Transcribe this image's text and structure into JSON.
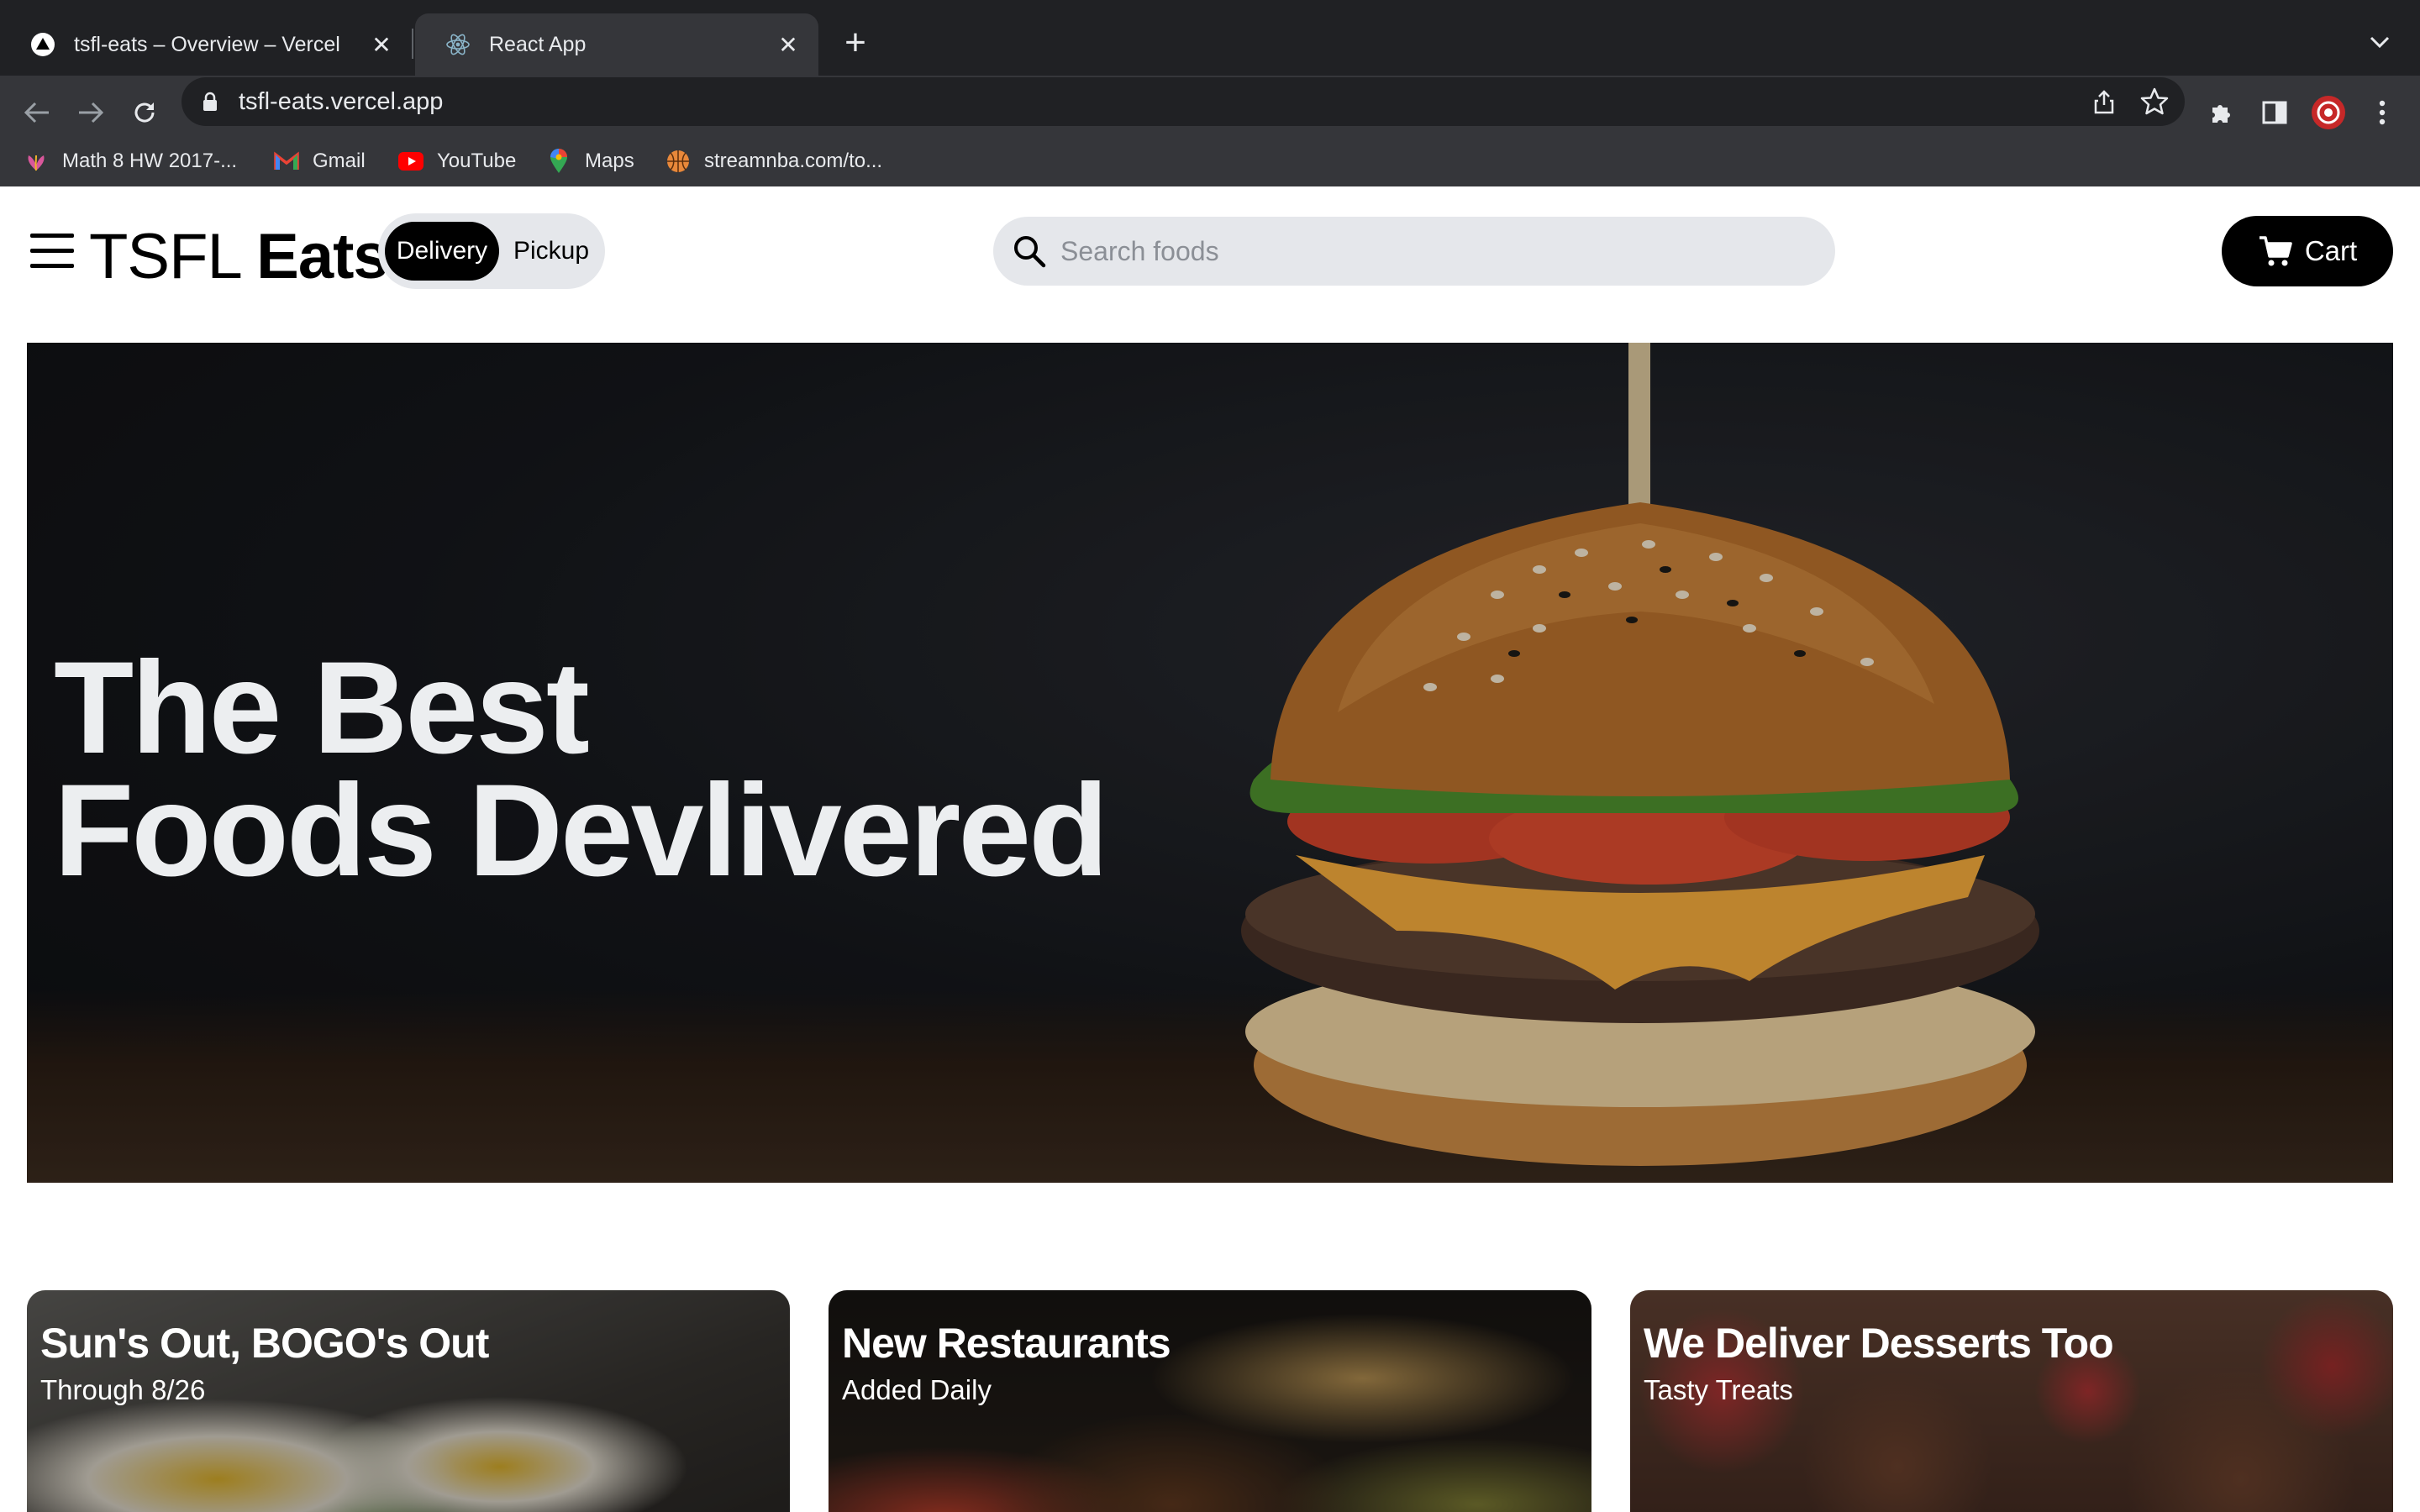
{
  "browser": {
    "tabs": [
      {
        "title": "tsfl-eats – Overview – Vercel",
        "icon": "vercel-triangle-icon",
        "active": false
      },
      {
        "title": "React App",
        "icon": "react-logo-icon",
        "active": true
      }
    ],
    "url": "tsfl-eats.vercel.app",
    "bookmarks": [
      {
        "label": "Math 8 HW 2017-...",
        "icon": "flower-icon"
      },
      {
        "label": "Gmail",
        "icon": "gmail-icon"
      },
      {
        "label": "YouTube",
        "icon": "youtube-icon"
      },
      {
        "label": "Maps",
        "icon": "maps-pin-icon"
      },
      {
        "label": "streamnba.com/to...",
        "icon": "basketball-icon"
      }
    ]
  },
  "header": {
    "logo_light": "TSFL",
    "logo_bold": "Eats",
    "mode_options": [
      "Delivery",
      "Pickup"
    ],
    "selected_mode": "Delivery",
    "search_placeholder": "Search foods",
    "cart_label": "Cart"
  },
  "hero": {
    "line1": "The Best",
    "line2": "Foods Devlivered"
  },
  "cards": [
    {
      "title": "Sun's Out, BOGO's Out",
      "subtitle": "Through 8/26"
    },
    {
      "title": "New Restaurants",
      "subtitle": "Added Daily"
    },
    {
      "title": "We Deliver Desserts Too",
      "subtitle": "Tasty Treats"
    }
  ],
  "colors": {
    "chrome_dark": "#202124",
    "chrome_toolbar": "#35363a",
    "accent_black": "#000000",
    "pill_gray": "#e5e7eb"
  }
}
